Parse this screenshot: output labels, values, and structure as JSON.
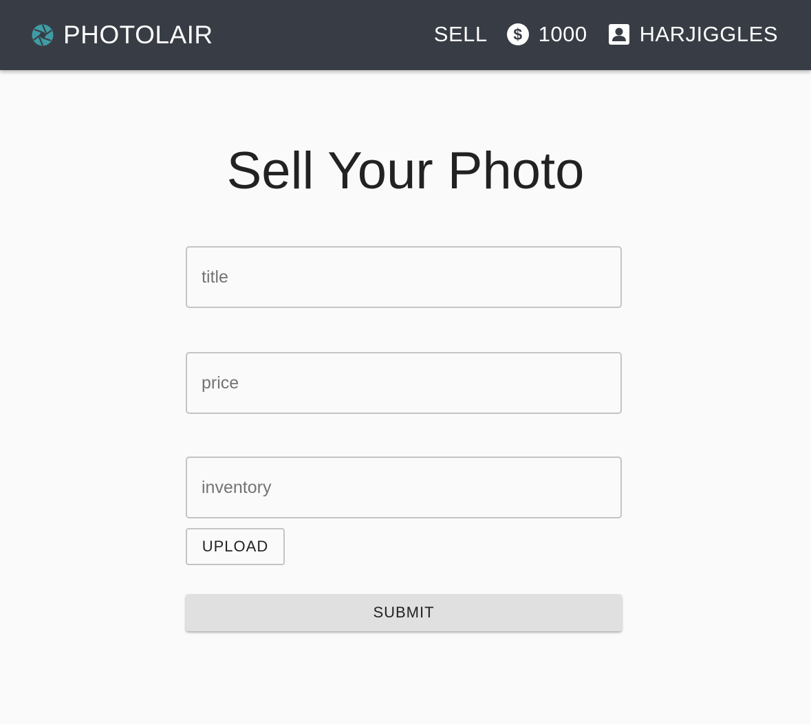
{
  "header": {
    "brand": "PHOTOLAIR",
    "brand_icon": "camera-aperture-icon",
    "brand_icon_color": "#3f9ca4",
    "background": "#383d45",
    "nav": {
      "sell_label": "SELL",
      "balance_icon": "dollar-circle-icon",
      "balance": "1000",
      "user_icon": "account-box-icon",
      "username": "HARJIGGLES"
    }
  },
  "main": {
    "title": "Sell Your Photo",
    "fields": {
      "title": {
        "value": "",
        "placeholder": "title"
      },
      "price": {
        "value": "",
        "placeholder": "price"
      },
      "inventory": {
        "value": "",
        "placeholder": "inventory"
      }
    },
    "upload_label": "UPLOAD",
    "submit_label": "SUBMIT"
  }
}
